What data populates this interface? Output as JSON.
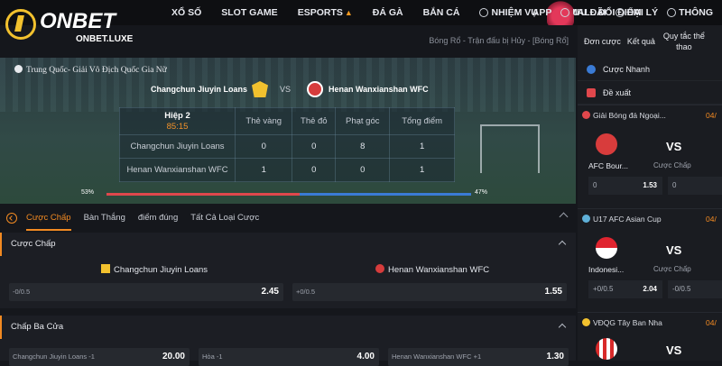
{
  "brand": {
    "name": "ONBET",
    "sub": "ONBET.LUXE"
  },
  "nav": {
    "items": [
      "XỔ SỐ",
      "SLOT GAME",
      "ESPORTS",
      "ĐÁ GÀ",
      "BẮN CÁ",
      "NHIỆM VỤ",
      "MALL ĐỔI ĐIỂM",
      "APP"
    ],
    "right": [
      "ƯU ĐÃI",
      "ĐẠI LÝ",
      "THÔNG"
    ]
  },
  "breadcrumb": "Bóng Rổ - Trận đấu bị Hủy - [Bóng Rổ]",
  "match": {
    "league": "Trung Quốc- Giải Vô Địch Quốc Gia Nữ",
    "home": "Changchun Jiuyin Loans",
    "away": "Henan Wanxianshan WFC",
    "vs": "VS",
    "period": "Hiệp 2",
    "clock": "85:15",
    "headers": [
      "Thẻ vàng",
      "Thẻ đỏ",
      "Phạt góc",
      "Tổng điểm"
    ],
    "home_stats": [
      "0",
      "0",
      "8",
      "1"
    ],
    "away_stats": [
      "1",
      "0",
      "0",
      "1"
    ],
    "possession_home": "53%",
    "possession_away": "47%",
    "possession_home_value": 53
  },
  "tabs": [
    "Cược Chấp",
    "Bàn Thắng",
    "điểm đúng",
    "Tất Cả Loại Cược"
  ],
  "handicap": {
    "title": "Cược Chấp",
    "home": "Changchun Jiuyin Loans",
    "away": "Henan Wanxianshan WFC",
    "home_line": "-0/0.5",
    "home_odds": "2.45",
    "away_line": "+0/0.5",
    "away_odds": "1.55"
  },
  "three_way": {
    "title": "Chấp Ba Cửa",
    "cells": [
      {
        "label": "Changchun Jiuyin Loans -1",
        "odds": "20.00"
      },
      {
        "label": "Hòa -1",
        "odds": "4.00"
      },
      {
        "label": "Henan Wanxianshan WFC +1",
        "odds": "1.30"
      }
    ]
  },
  "right_panel": {
    "links": [
      "Đơn cược",
      "Kết quả",
      "Quy tắc thể thao"
    ],
    "quick": "Cược Nhanh",
    "suggest": "Đề xuất",
    "cards": [
      {
        "league": "Giải Bóng đá Ngoại...",
        "date": "04/",
        "team": "AFC Bour...",
        "vs": "VS",
        "market": "Cược Chấp",
        "odds": [
          {
            "label": "0",
            "value": "1.53"
          },
          {
            "label": "0",
            "value": ""
          }
        ]
      },
      {
        "league": "U17 AFC Asian Cup",
        "date": "04/",
        "team": "Indonesi...",
        "vs": "VS",
        "market": "Cược Chấp",
        "odds": [
          {
            "label": "+0/0.5",
            "value": "2.04"
          },
          {
            "label": "-0/0.5",
            "value": ""
          }
        ]
      },
      {
        "league": "VĐQG Tây Ban Nha",
        "date": "04/",
        "team": "",
        "vs": "VS",
        "market": "",
        "odds": []
      }
    ]
  },
  "colors": {
    "accent": "#f28a22",
    "home_bar": "#e0474c",
    "away_bar": "#3a7bd5"
  }
}
